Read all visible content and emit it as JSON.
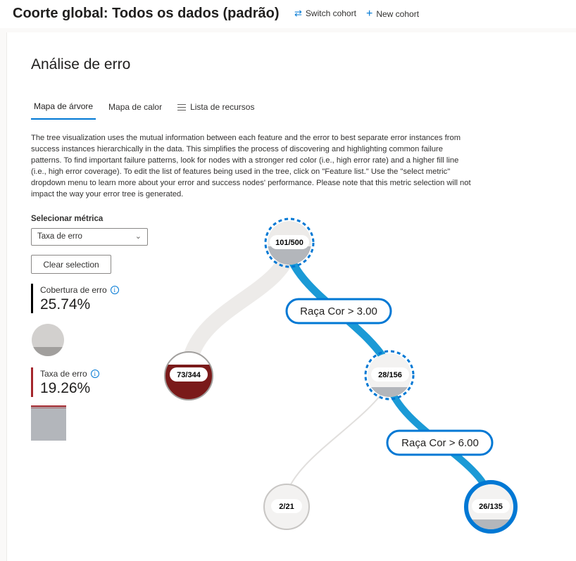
{
  "header": {
    "cohort_title": "Coorte global: Todos os dados (padrão)",
    "switch_label": "Switch cohort",
    "new_label": "New cohort"
  },
  "panel": {
    "title": "Análise de erro",
    "tabs": [
      {
        "label": "Mapa de árvore",
        "active": true
      },
      {
        "label": "Mapa de calor",
        "active": false
      },
      {
        "label": "Lista de recursos",
        "active": false,
        "icon": "list-icon"
      }
    ],
    "description": "The tree visualization uses the mutual information between each feature and the error to best separate error instances from success instances hierarchically in the data. This simplifies the process of discovering and highlighting common failure patterns. To find important failure patterns, look for nodes with a stronger red color (i.e., high error rate) and a higher fill line (i.e., high error coverage). To edit the list of features being used in the tree, click on \"Feature list.\" Use the \"select metric\" dropdown menu to learn more about your error and success nodes' performance. Please note that this metric selection will not impact the way your error tree is generated."
  },
  "controls": {
    "select_metric_label": "Selecionar métrica",
    "select_metric_value": "Taxa de erro",
    "clear_selection_label": "Clear selection"
  },
  "metrics": {
    "coverage": {
      "label": "Cobertura de erro",
      "value": "25.74%",
      "fill_fraction": 0.2574
    },
    "error_rate": {
      "label": "Taxa de erro",
      "value": "19.26%",
      "fill_fraction": 0.1926
    }
  },
  "tree": {
    "nodes": [
      {
        "id": "root",
        "label": "101/500",
        "errors": 101,
        "total": 500,
        "selected": true
      },
      {
        "id": "left",
        "label": "73/344",
        "errors": 73,
        "total": 344,
        "selected": false
      },
      {
        "id": "mid",
        "label": "28/156",
        "errors": 28,
        "total": 156,
        "selected": true
      },
      {
        "id": "leaf_a",
        "label": "2/21",
        "errors": 2,
        "total": 21,
        "selected": false
      },
      {
        "id": "leaf_b",
        "label": "26/135",
        "errors": 26,
        "total": 135,
        "selected": true
      }
    ],
    "splits": [
      {
        "label": "Raça Cor > 3.00"
      },
      {
        "label": "Raça Cor > 6.00"
      }
    ]
  },
  "colors": {
    "accent": "#0078d4",
    "selected_path": "#1b9ad6",
    "error_red": "#7a1a1a",
    "node_fill_gray": "#b3b6bb",
    "coverage_bar": "#000000",
    "error_bar": "#a4262c"
  }
}
